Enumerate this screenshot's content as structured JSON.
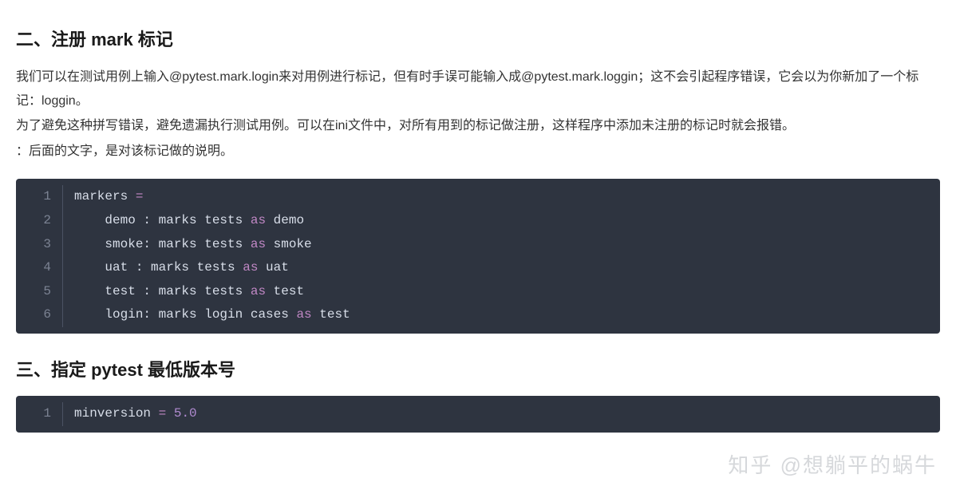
{
  "section1": {
    "heading": "二、注册 mark 标记",
    "p1": "我们可以在测试用例上输入@pytest.mark.login来对用例进行标记，但有时手误可能输入成@pytest.mark.loggin；这不会引起程序错误，它会以为你新加了一个标记：loggin。",
    "p2": "为了避免这种拼写错误，避免遗漏执行测试用例。可以在ini文件中，对所有用到的标记做注册，这样程序中添加未注册的标记时就会报错。",
    "p3": "：后面的文字，是对该标记做的说明。"
  },
  "code1": {
    "lines": [
      {
        "n": "1",
        "pre": "markers ",
        "op": "=",
        "post": ""
      },
      {
        "n": "2",
        "pre": "    demo : marks tests ",
        "kw": "as",
        "post": " demo"
      },
      {
        "n": "3",
        "pre": "    smoke: marks tests ",
        "kw": "as",
        "post": " smoke"
      },
      {
        "n": "4",
        "pre": "    uat : marks tests ",
        "kw": "as",
        "post": " uat"
      },
      {
        "n": "5",
        "pre": "    test : marks tests ",
        "kw": "as",
        "post": " test"
      },
      {
        "n": "6",
        "pre": "    login: marks login cases ",
        "kw": "as",
        "post": " test"
      }
    ]
  },
  "section2": {
    "heading": "三、指定 pytest 最低版本号"
  },
  "code2": {
    "lines": [
      {
        "n": "1",
        "pre": "minversion ",
        "op": "=",
        "post": " ",
        "val": "5.0"
      }
    ]
  },
  "watermark": "知乎 @想躺平的蜗牛"
}
